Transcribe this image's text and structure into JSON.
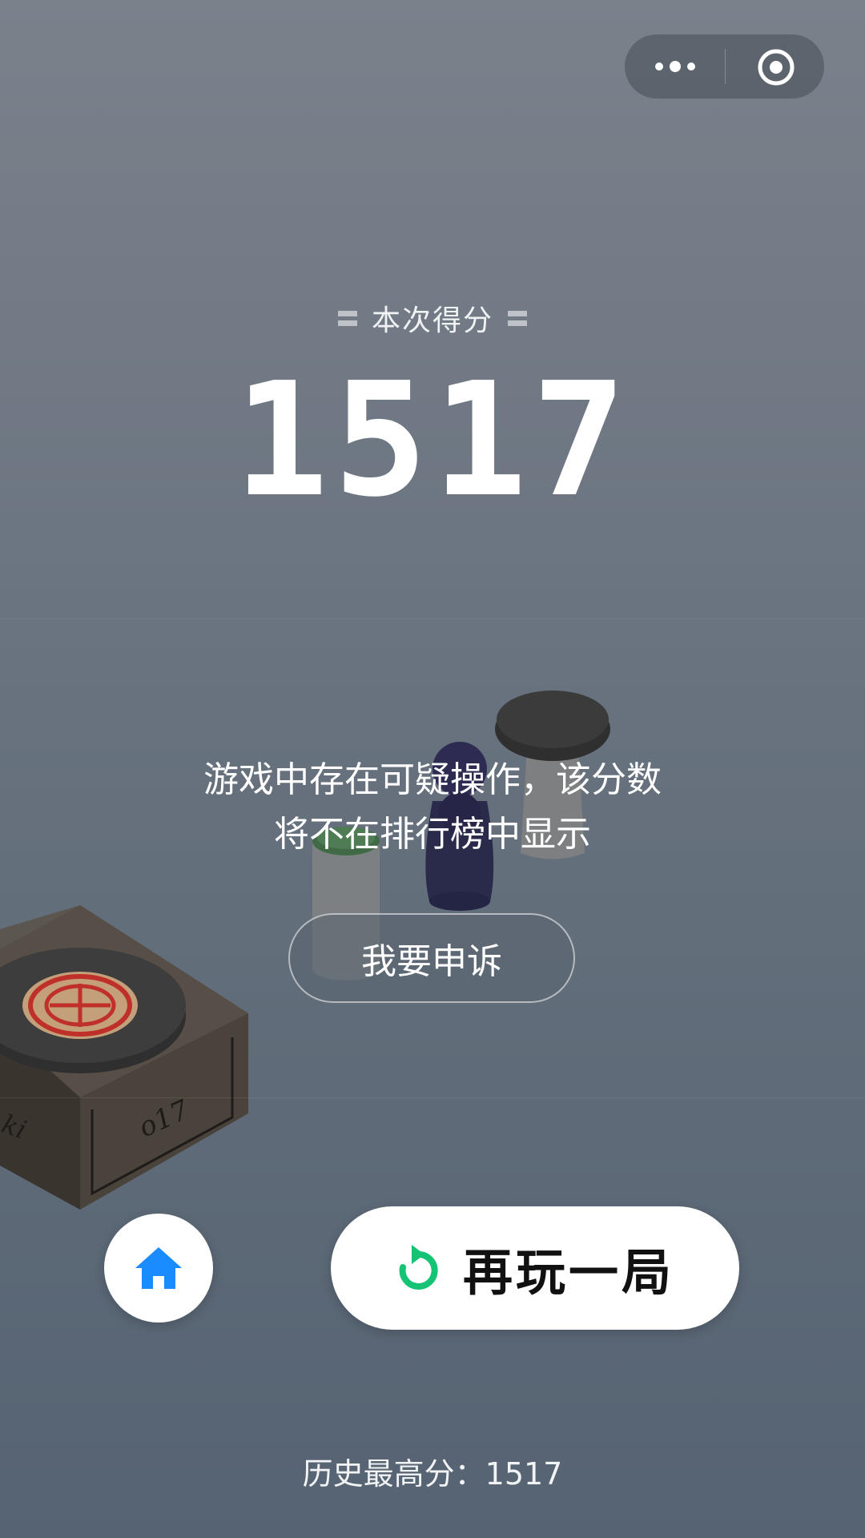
{
  "capsule": {
    "more_icon": "more-dots-icon",
    "close_icon": "target-circle-icon"
  },
  "score": {
    "label": "本次得分",
    "value": "1517"
  },
  "warning": {
    "line1": "游戏中存在可疑操作，该分数",
    "line2": "将不在排行榜中显示"
  },
  "appeal_button": {
    "label": "我要申诉"
  },
  "home_button": {
    "icon": "home-icon",
    "color": "#1a8cff"
  },
  "replay_button": {
    "icon": "replay-icon",
    "icon_color": "#14c474",
    "label": "再玩一局"
  },
  "history": {
    "label": "历史最高分：",
    "value": "1517"
  },
  "scene": {
    "box_text_left": "ki",
    "box_text_right": "o17"
  }
}
